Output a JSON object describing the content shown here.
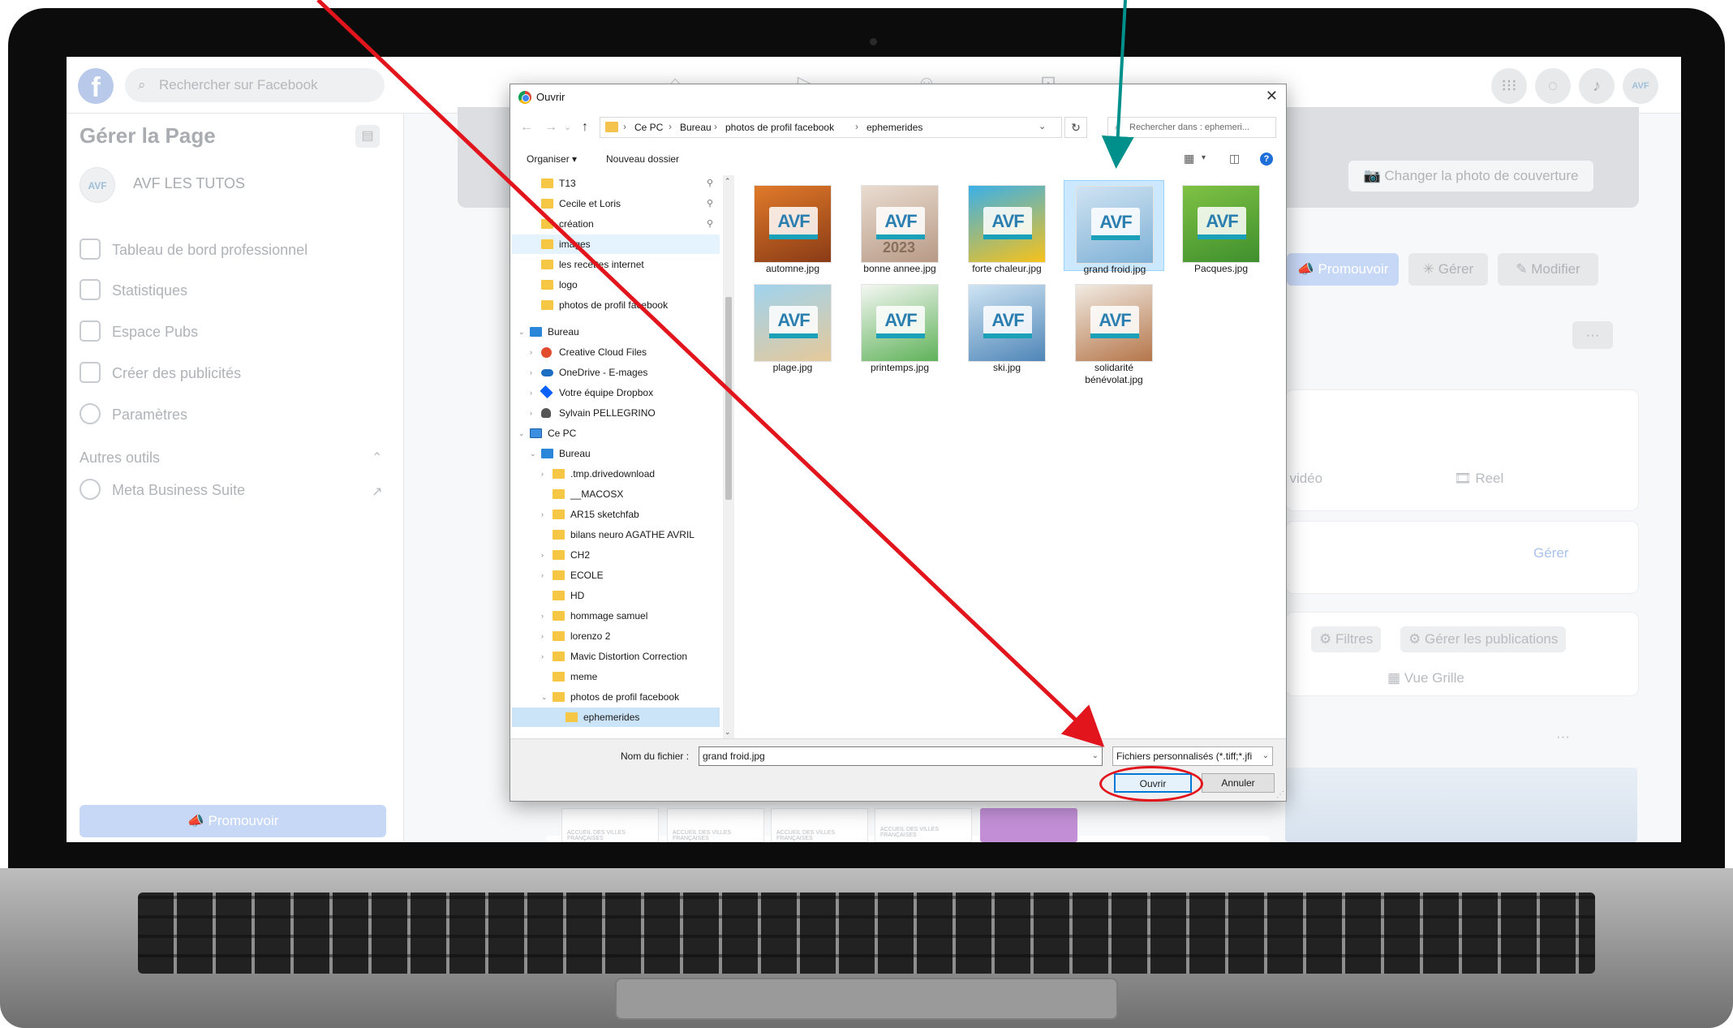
{
  "facebook": {
    "search_placeholder": "Rechercher sur Facebook",
    "sidebar_title": "Gérer la Page",
    "page_avatar_text": "AVF",
    "page_name": "AVF LES TUTOS",
    "sidebar_items": [
      "Tableau de bord professionnel",
      "Statistiques",
      "Espace Pubs",
      "Créer des publicités",
      "Paramètres"
    ],
    "other_tools": "Autres outils",
    "meta_business": "Meta Business Suite",
    "promote_sidebar": "Promouvoir",
    "change_cover": "Changer la photo de couverture",
    "actions": [
      "Promouvoir",
      "Gérer",
      "Modifier"
    ],
    "video_tab": "/ vidéo",
    "reel": "Reel",
    "manage_link": "Gérer",
    "filters": "Filtres",
    "manage_posts": "Gérer les publications",
    "grid_view": "Vue Grille",
    "more": "···",
    "thumb_caption": "ACCUEIL DES VILLES FRANÇAISES"
  },
  "dialog": {
    "title": "Ouvrir",
    "breadcrumbs": [
      "Ce PC",
      "Bureau",
      "photos de profil facebook",
      "ephemerides"
    ],
    "search_placeholder": "Rechercher dans : ephemeri...",
    "organize": "Organiser ▾",
    "new_folder": "Nouveau dossier",
    "tree": [
      {
        "label": "T13",
        "pinned": true
      },
      {
        "label": "Cecile et Loris",
        "pinned": true
      },
      {
        "label": "création",
        "pinned": true
      },
      {
        "label": "images",
        "highlight": true
      },
      {
        "label": "les recettes internet"
      },
      {
        "label": "logo"
      },
      {
        "label": "photos de profil facebook"
      },
      {
        "label": "Bureau"
      },
      {
        "label": "Creative Cloud Files"
      },
      {
        "label": "OneDrive - E-mages"
      },
      {
        "label": "Votre équipe Dropbox"
      },
      {
        "label": "Sylvain PELLEGRINO"
      },
      {
        "label": "Ce PC"
      },
      {
        "label": "Bureau"
      },
      {
        "label": ".tmp.drivedownload"
      },
      {
        "label": "__MACOSX"
      },
      {
        "label": "AR15 sketchfab"
      },
      {
        "label": "bilans neuro AGATHE AVRIL"
      },
      {
        "label": "CH2"
      },
      {
        "label": "ECOLE"
      },
      {
        "label": "HD"
      },
      {
        "label": "hommage samuel"
      },
      {
        "label": "lorenzo 2"
      },
      {
        "label": "Mavic Distortion Correction"
      },
      {
        "label": "meme"
      },
      {
        "label": "photos de profil facebook"
      },
      {
        "label": "ephemerides",
        "selected": true
      }
    ],
    "files": [
      {
        "name": "automne.jpg",
        "colors": [
          "#e07a2a",
          "#8a3b16"
        ]
      },
      {
        "name": "bonne annee.jpg",
        "colors": [
          "#e9dcd0",
          "#b89a86"
        ],
        "extra": "2023"
      },
      {
        "name": "forte chaleur.jpg",
        "colors": [
          "#3bb0e8",
          "#f7c21a"
        ]
      },
      {
        "name": "grand froid.jpg",
        "colors": [
          "#cfe3f2",
          "#7fb1d6"
        ],
        "selected": true
      },
      {
        "name": "Pacques.jpg",
        "colors": [
          "#7fc244",
          "#3f8f2e"
        ]
      },
      {
        "name": "plage.jpg",
        "colors": [
          "#9fd3ee",
          "#e6c99a"
        ]
      },
      {
        "name": "printemps.jpg",
        "colors": [
          "#f4f7f2",
          "#5fb25a"
        ]
      },
      {
        "name": "ski.jpg",
        "colors": [
          "#cfe4f3",
          "#4f86b8"
        ]
      },
      {
        "name": "solidarité bénévolat.jpg",
        "colors": [
          "#f1ebe3",
          "#b5764a"
        ]
      }
    ],
    "filename_label": "Nom du fichier :",
    "filename_value": "grand froid.jpg",
    "filetype": "Fichiers personnalisés (*.tiff;*.jfi",
    "open_button": "Ouvrir",
    "cancel_button": "Annuler"
  },
  "colors": {
    "annotation_red": "#e2141c",
    "annotation_teal": "#00908c",
    "selection_blue": "#cce8ff",
    "accent": "#0078d7"
  }
}
